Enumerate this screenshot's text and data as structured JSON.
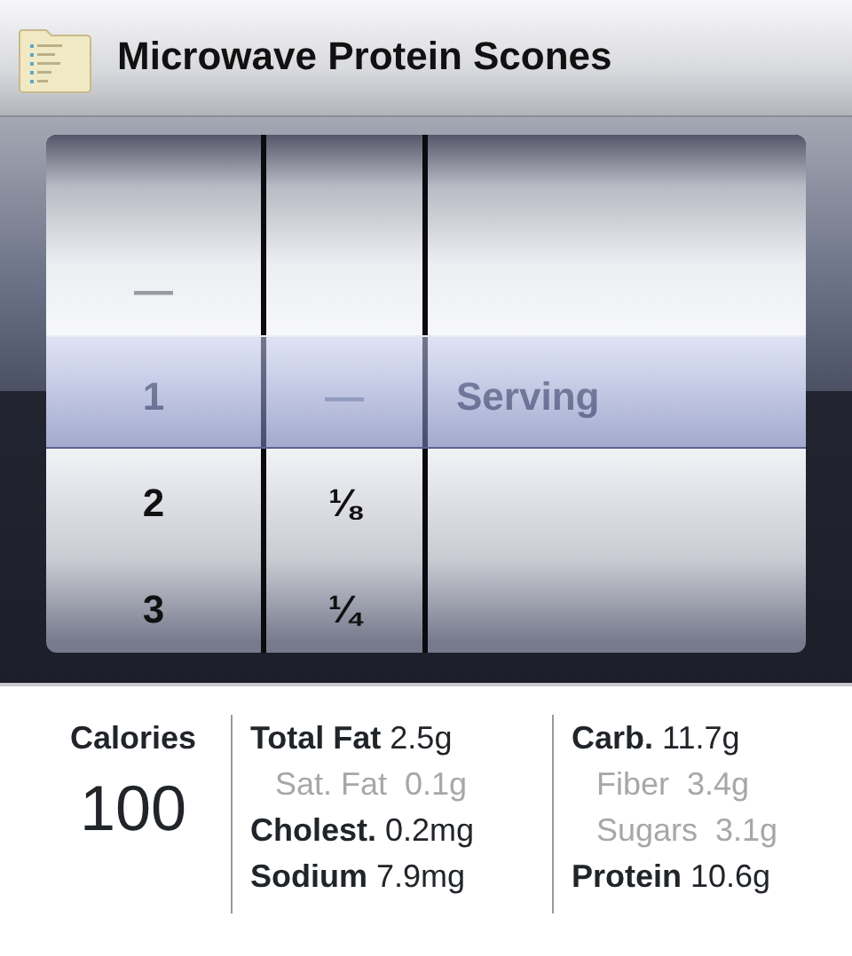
{
  "header": {
    "title": "Microwave Protein Scones"
  },
  "picker": {
    "wheels": [
      {
        "items": [
          {
            "label": "—",
            "kind": "dash",
            "selected": false
          },
          {
            "label": "1",
            "kind": "value",
            "selected": true
          },
          {
            "label": "2",
            "kind": "value",
            "selected": false
          },
          {
            "label": "3",
            "kind": "value",
            "selected": false
          }
        ]
      },
      {
        "items": [
          {
            "label": "—",
            "kind": "dash",
            "selected": true
          },
          {
            "label": "⅛",
            "kind": "value",
            "selected": false
          },
          {
            "label": "¼",
            "kind": "value",
            "selected": false
          }
        ]
      },
      {
        "items": [
          {
            "label": "Serving",
            "kind": "value",
            "selected": true
          }
        ]
      }
    ]
  },
  "nutrition": {
    "calories": {
      "label": "Calories",
      "value": "100"
    },
    "columns": [
      [
        {
          "label": "Total Fat",
          "value": "2.5g",
          "kind": "main"
        },
        {
          "label": "Sat. Fat",
          "value": "0.1g",
          "kind": "sub"
        },
        {
          "label": "Cholest.",
          "value": "0.2mg",
          "kind": "main"
        },
        {
          "label": "Sodium",
          "value": "7.9mg",
          "kind": "main"
        }
      ],
      [
        {
          "label": "Carb.",
          "value": "11.7g",
          "kind": "main"
        },
        {
          "label": "Fiber",
          "value": "3.4g",
          "kind": "sub"
        },
        {
          "label": "Sugars",
          "value": "3.1g",
          "kind": "sub"
        },
        {
          "label": "Protein",
          "value": "10.6g",
          "kind": "main"
        }
      ]
    ]
  }
}
